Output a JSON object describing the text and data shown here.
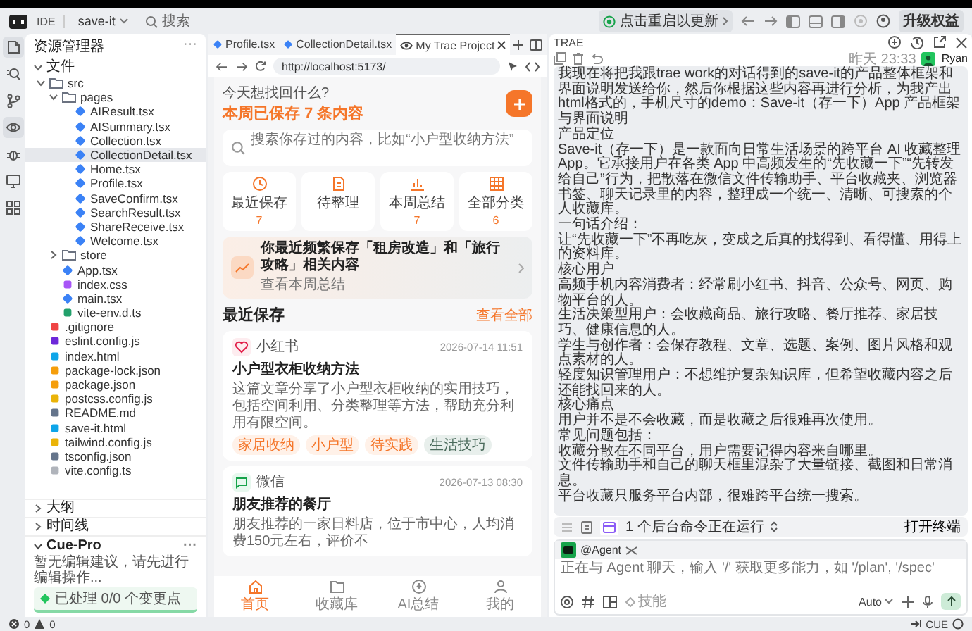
{
  "topbar": {
    "ide_label": "IDE",
    "project": "save-it",
    "search": "搜索",
    "update_notice": "点击重启以更新",
    "upgrade": "升级权益"
  },
  "activity": [
    {
      "kind": "files",
      "selected": true
    },
    {
      "kind": "search",
      "selected": false
    },
    {
      "kind": "branch",
      "selected": false
    },
    {
      "kind": "eye",
      "selected": true
    },
    {
      "kind": "bug",
      "selected": false
    },
    {
      "kind": "monitor",
      "selected": false
    },
    {
      "kind": "grid",
      "selected": false
    }
  ],
  "explorer": {
    "title": "资源管理器",
    "menu": "···",
    "section": "文件",
    "tree": [
      {
        "name": "src",
        "kind": "folder",
        "expanded": true,
        "selected": false,
        "children": [
          {
            "name": "pages",
            "kind": "folder",
            "expanded": true,
            "selected": false,
            "children": [
              {
                "name": "AIResult.tsx",
                "kind": "tsx",
                "selected": false
              },
              {
                "name": "AISummary.tsx",
                "kind": "tsx",
                "selected": false
              },
              {
                "name": "Collection.tsx",
                "kind": "tsx",
                "selected": false
              },
              {
                "name": "CollectionDetail.tsx",
                "kind": "tsx",
                "selected": true
              },
              {
                "name": "Home.tsx",
                "kind": "tsx",
                "selected": false
              },
              {
                "name": "Profile.tsx",
                "kind": "tsx",
                "selected": false
              },
              {
                "name": "SaveConfirm.tsx",
                "kind": "tsx",
                "selected": false
              },
              {
                "name": "SearchResult.tsx",
                "kind": "tsx",
                "selected": false
              },
              {
                "name": "ShareReceive.tsx",
                "kind": "tsx",
                "selected": false
              },
              {
                "name": "Welcome.tsx",
                "kind": "tsx",
                "selected": false
              }
            ]
          },
          {
            "name": "store",
            "kind": "folder",
            "expanded": false,
            "selected": false
          },
          {
            "name": "App.tsx",
            "kind": "tsx",
            "selected": false
          },
          {
            "name": "index.css",
            "kind": "css",
            "selected": false
          },
          {
            "name": "main.tsx",
            "kind": "tsx",
            "selected": false
          },
          {
            "name": "vite-env.d.ts",
            "kind": "ts",
            "selected": false
          }
        ]
      },
      {
        "name": ".gitignore",
        "kind": "git",
        "selected": false
      },
      {
        "name": "eslint.config.js",
        "kind": "eslint",
        "selected": false
      },
      {
        "name": "index.html",
        "kind": "html",
        "selected": false
      },
      {
        "name": "package-lock.json",
        "kind": "json",
        "selected": false
      },
      {
        "name": "package.json",
        "kind": "json",
        "selected": false
      },
      {
        "name": "postcss.config.js",
        "kind": "js",
        "selected": false
      },
      {
        "name": "README.md",
        "kind": "info",
        "selected": false
      },
      {
        "name": "save-it.html",
        "kind": "html",
        "selected": false
      },
      {
        "name": "tailwind.config.js",
        "kind": "js",
        "selected": false
      },
      {
        "name": "tsconfig.json",
        "kind": "config",
        "selected": false
      },
      {
        "name": "vite.config.ts",
        "kind": "plain",
        "selected": false
      }
    ],
    "panels": [
      {
        "label": "大纲",
        "expanded": false
      },
      {
        "label": "时间线",
        "expanded": false
      }
    ],
    "cue_pro": {
      "title": "Cue-Pro",
      "expanded": true,
      "menu": "···",
      "message": "暂无编辑建议，请先进行编辑操作...",
      "processed": "已处理 0/0 个变更点"
    }
  },
  "editor": {
    "tabs": [
      {
        "label": "Profile.tsx",
        "kind": "file",
        "selected": false
      },
      {
        "label": "CollectionDetail.tsx",
        "kind": "file",
        "selected": false
      },
      {
        "label": "My Trae Project",
        "kind": "preview",
        "selected": true
      }
    ],
    "url": "http://localhost:5173/"
  },
  "phone": {
    "greeting": "今天想找回什么?",
    "summary": "本周已保存 7 条内容",
    "search_placeholder": "搜索你存过的内容，比如“小户型收纳方法”",
    "tiles": [
      {
        "label": "最近保存",
        "count": "7",
        "kind": "clock"
      },
      {
        "label": "待整理",
        "kind": "doc"
      },
      {
        "label": "本周总结",
        "count": "7",
        "kind": "chart"
      },
      {
        "label": "全部分类",
        "count": "6",
        "kind": "grid"
      }
    ],
    "insight": {
      "text": "你最近频繁保存「租房改造」和「旅行攻略」相关内容",
      "link": "查看本周总结"
    },
    "recent_title": "最近保存",
    "view_all": "查看全部",
    "cards": [
      {
        "source": "小红书",
        "kind": "heart",
        "time": "2026-07-14 11:51",
        "title": "小户型衣柜收纳方法",
        "desc": "这篇文章分享了小户型衣柜收纳的实用技巧，包括空间利用、分类整理等方法，帮助充分利用有限空间。",
        "tags": [
          {
            "label": "家居收纳",
            "kind": "keyword"
          },
          {
            "label": "小户型",
            "kind": "keyword"
          },
          {
            "label": "待实践",
            "kind": "keyword"
          },
          {
            "label": "生活技巧",
            "kind": "category"
          }
        ]
      },
      {
        "source": "微信",
        "kind": "chat",
        "time": "2026-07-13 08:30",
        "title": "朋友推荐的餐厅",
        "desc": "朋友推荐的一家日料店，位于市中心，人均消费150元左右，评价不"
      }
    ],
    "nav": [
      {
        "label": "首页",
        "kind": "home",
        "selected": true
      },
      {
        "label": "收藏库",
        "kind": "folder",
        "selected": false
      },
      {
        "label": "AI总结",
        "kind": "ai",
        "selected": false
      },
      {
        "label": "我的",
        "kind": "user",
        "selected": false
      }
    ]
  },
  "chat": {
    "title": "TRAE",
    "time": "昨天 23:33",
    "user": "Ryan",
    "message": [
      "我现在将把我跟trae work的对话得到的save-it的产品整体框架和界面说明发送给你，然后你根据这些内容再进行分析，为我产出html格式的，手机尺寸的demo：Save-it（存一下）App 产品框架与界面说明",
      "产品定位",
      "Save-it（存一下）是一款面向日常生活场景的跨平台 AI 收藏整理 App。它承接用户在各类 App 中高频发生的“先收藏一下”“先转发给自己”行为，把散落在微信文件传输助手、平台收藏夹、浏览器书签、聊天记录里的内容，整理成一个统一、清晰、可搜索的个人收藏库。",
      "一句话介绍：",
      "让“先收藏一下”不再吃灰，变成之后真的找得到、看得懂、用得上的资料库。",
      "核心用户",
      "高频手机内容消费者：经常刷小红书、抖音、公众号、网页、购物平台的人。",
      "生活决策型用户：会收藏商品、旅行攻略、餐厅推荐、家居技巧、健康信息的人。",
      "学生与创作者：会保存教程、文章、选题、案例、图片风格和观点素材的人。",
      "轻度知识管理用户：不想维护复杂知识库，但希望收藏内容之后还能找回来的人。",
      "核心痛点",
      "用户并不是不会收藏，而是收藏之后很难再次使用。",
      "常见问题包括：",
      "收藏分散在不同平台，用户需要记得内容来自哪里。",
      "文件传输助手和自己的聊天框里混杂了大量链接、截图和日常消息。",
      "平台收藏只服务平台内部，很难跨平台统一搜索。"
    ],
    "background_task": "1 个后台命令正在运行",
    "open_terminal": "打开终端",
    "agent": "@Agent",
    "input_placeholder": "正在与 Agent 聊天，输入 '/' 获取更多能力，如 '/plan', '/spec'",
    "skill": "技能",
    "model": "Auto"
  },
  "status": {
    "errors": "0",
    "warnings": "0",
    "cue": "CUE"
  }
}
